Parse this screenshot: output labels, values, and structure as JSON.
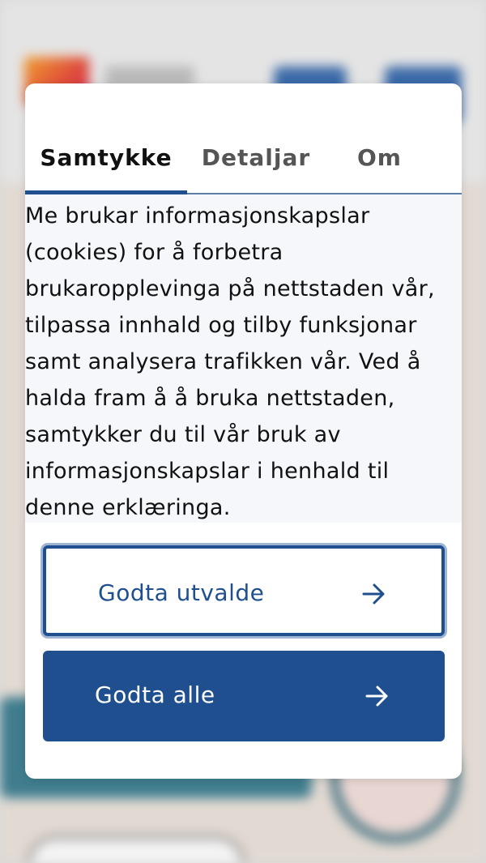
{
  "consent": {
    "tabs": [
      {
        "label": "Samtykke",
        "active": true
      },
      {
        "label": "Detaljar",
        "active": false
      },
      {
        "label": "Om",
        "active": false
      }
    ],
    "body": "Me brukar informasjonskapslar (cookies) for å forbetra brukaropplevinga på nettstaden vår, tilpassa innhald og tilby funksjonar samt analysera trafikken vår. Ved å halda fram å å bruka nettstaden, samtykker du til vår bruk av informasjonskapslar i henhald til denne erklæringa.",
    "buttons": {
      "accept_selected": "Godta utvalde",
      "accept_all": "Godta alle"
    },
    "icons": {
      "arrow": "arrow-right-icon"
    },
    "colors": {
      "primary": "#1f4f8f",
      "tab_border": "#5b7fa8",
      "text_bg": "#f5f7fb"
    }
  }
}
